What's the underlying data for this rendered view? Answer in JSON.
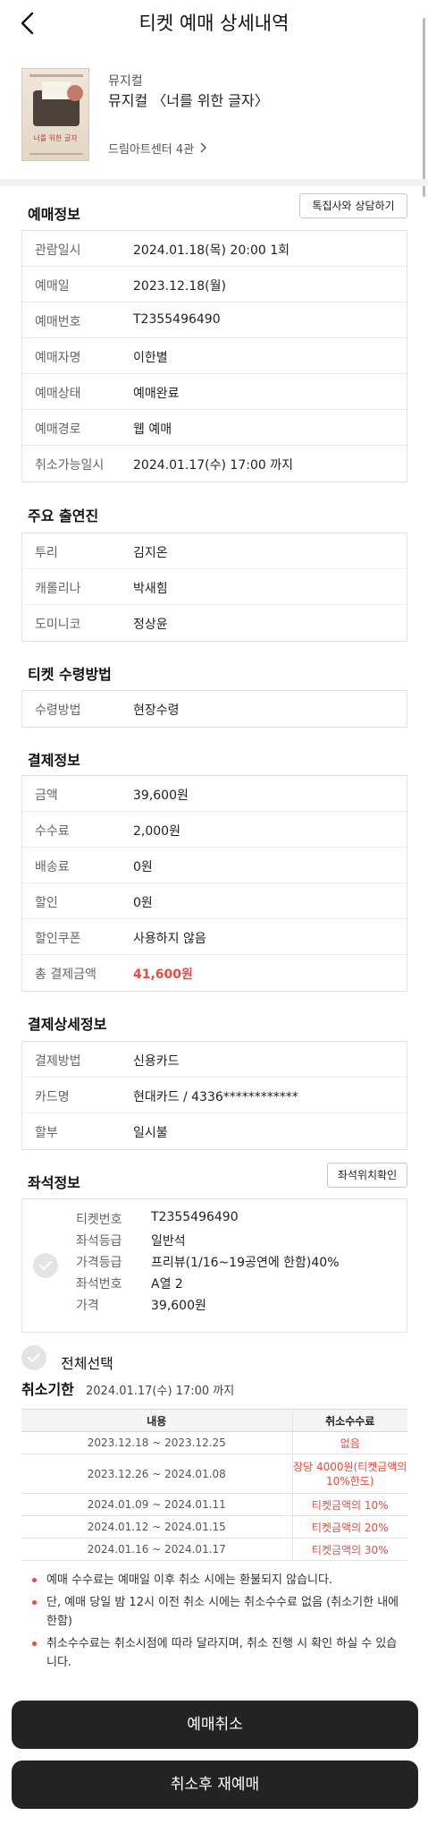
{
  "header": {
    "title": "티켓 예매 상세내역"
  },
  "product": {
    "genre": "뮤지컬",
    "name": "뮤지컬 〈너를 위한 글자〉",
    "venue": "드림아트센터 4관",
    "poster_title": "너를 위한 글자"
  },
  "booking": {
    "title": "예매정보",
    "consult_button": "톡집사와 상담하기",
    "rows": [
      {
        "label": "관람일시",
        "value": "2024.01.18(목) 20:00 1회"
      },
      {
        "label": "예매일",
        "value": "2023.12.18(월)"
      },
      {
        "label": "예매번호",
        "value": "T2355496490"
      },
      {
        "label": "예매자명",
        "value": "이한별"
      },
      {
        "label": "예매상태",
        "value": "예매완료"
      },
      {
        "label": "예매경로",
        "value": "웹 예매"
      },
      {
        "label": "취소가능일시",
        "value": "2024.01.17(수) 17:00 까지"
      }
    ]
  },
  "cast": {
    "title": "주요 출연진",
    "rows": [
      {
        "label": "투리",
        "value": "김지온"
      },
      {
        "label": "캐롤리나",
        "value": "박새힘"
      },
      {
        "label": "도미니코",
        "value": "정상윤"
      }
    ]
  },
  "delivery": {
    "title": "티켓 수령방법",
    "rows": [
      {
        "label": "수령방법",
        "value": "현장수령"
      }
    ]
  },
  "payment": {
    "title": "결제정보",
    "rows": [
      {
        "label": "금액",
        "value": "39,600원"
      },
      {
        "label": "수수료",
        "value": "2,000원"
      },
      {
        "label": "배송료",
        "value": "0원"
      },
      {
        "label": "할인",
        "value": "0원"
      },
      {
        "label": "할인쿠폰",
        "value": "사용하지 않음"
      },
      {
        "label": "총 결제금액",
        "value": "41,600원"
      }
    ]
  },
  "payment_detail": {
    "title": "결제상세정보",
    "rows": [
      {
        "label": "결제방법",
        "value": "신용카드"
      },
      {
        "label": "카드명",
        "value": "현대카드 / 4336************"
      },
      {
        "label": "할부",
        "value": "일시불"
      }
    ]
  },
  "seat": {
    "title": "좌석정보",
    "location_button": "좌석위치확인",
    "rows": [
      {
        "label": "티켓번호",
        "value": "T2355496490"
      },
      {
        "label": "좌석등급",
        "value": "일반석"
      },
      {
        "label": "가격등급",
        "value": "프리뷰(1/16~19공연에 한함)40%"
      },
      {
        "label": "좌석번호",
        "value": "A열 2"
      },
      {
        "label": "가격",
        "value": "39,600원"
      }
    ],
    "select_all": "전체선택"
  },
  "cancel": {
    "title": "취소기한",
    "deadline": "2024.01.17(수) 17:00 까지",
    "table_headers": [
      "내용",
      "취소수수료"
    ],
    "table_rows": [
      {
        "period": "2023.12.18 ~ 2023.12.25",
        "fee": "없음"
      },
      {
        "period": "2023.12.26 ~ 2024.01.08",
        "fee": "장당 4000원(티켓금액의 10%한도)"
      },
      {
        "period": "2024.01.09 ~ 2024.01.11",
        "fee": "티켓금액의 10%"
      },
      {
        "period": "2024.01.12 ~ 2024.01.15",
        "fee": "티켓금액의 20%"
      },
      {
        "period": "2024.01.16 ~ 2024.01.17",
        "fee": "티켓금액의 30%"
      }
    ],
    "notes": [
      "예매 수수료는 예매일 이후 취소 시에는 환불되지 않습니다.",
      "단, 예매 당일 밤 12시 이전 취소 시에는 취소수수료 없음 (취소기한 내에 한함)",
      "취소수수료는 취소시점에 따라 달라지며, 취소 진행 시 확인 하실 수 있습니다."
    ]
  },
  "actions": {
    "cancel_button": "예매취소",
    "rebook_button": "취소후 재예매"
  },
  "colors": {
    "accent_red": "#e44c3e",
    "button_dark": "#232323"
  }
}
